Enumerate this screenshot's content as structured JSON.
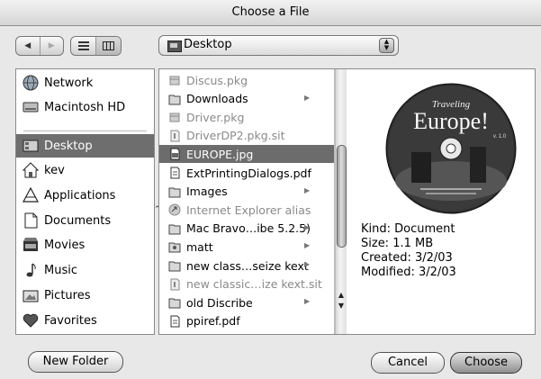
{
  "window": {
    "title": "Choose a File"
  },
  "toolbar": {
    "back_icon": "back-arrow-icon",
    "forward_icon": "forward-arrow-icon",
    "list_view_icon": "list-view-icon",
    "column_view_icon": "column-view-icon",
    "location": {
      "label": "Desktop",
      "icon": "desktop-icon"
    }
  },
  "sidebar": {
    "items": [
      {
        "label": "Network",
        "icon": "network-icon",
        "selected": false
      },
      {
        "label": "Macintosh HD",
        "icon": "hard-drive-icon",
        "selected": false
      },
      {
        "label": "Desktop",
        "icon": "desktop-icon",
        "selected": true
      },
      {
        "label": "kev",
        "icon": "home-icon",
        "selected": false
      },
      {
        "label": "Applications",
        "icon": "applications-icon",
        "selected": false
      },
      {
        "label": "Documents",
        "icon": "documents-icon",
        "selected": false
      },
      {
        "label": "Movies",
        "icon": "movies-icon",
        "selected": false
      },
      {
        "label": "Music",
        "icon": "music-icon",
        "selected": false
      },
      {
        "label": "Pictures",
        "icon": "pictures-icon",
        "selected": false
      },
      {
        "label": "Favorites",
        "icon": "favorites-icon",
        "selected": false
      }
    ]
  },
  "files": [
    {
      "name": "Discus.pkg",
      "icon": "package-icon",
      "dimmed": true,
      "folder": false,
      "selected": false
    },
    {
      "name": "Downloads",
      "icon": "folder-icon",
      "dimmed": false,
      "folder": true,
      "selected": false
    },
    {
      "name": "Driver.pkg",
      "icon": "package-icon",
      "dimmed": true,
      "folder": false,
      "selected": false
    },
    {
      "name": "DriverDP2.pkg.sit",
      "icon": "archive-icon",
      "dimmed": true,
      "folder": false,
      "selected": false
    },
    {
      "name": "EUROPE.jpg",
      "icon": "image-file-icon",
      "dimmed": false,
      "folder": false,
      "selected": true
    },
    {
      "name": "ExtPrintingDialogs.pdf",
      "icon": "pdf-icon",
      "dimmed": false,
      "folder": false,
      "selected": false
    },
    {
      "name": "Images",
      "icon": "folder-icon",
      "dimmed": false,
      "folder": true,
      "selected": false
    },
    {
      "name": "Internet Explorer alias",
      "icon": "alias-icon",
      "dimmed": true,
      "folder": false,
      "selected": false
    },
    {
      "name": "Mac Bravo…ibe 5.2.5)",
      "icon": "folder-icon",
      "dimmed": false,
      "folder": true,
      "selected": false
    },
    {
      "name": "matt",
      "icon": "user-folder-icon",
      "dimmed": false,
      "folder": true,
      "selected": false
    },
    {
      "name": "new class…seize kext",
      "icon": "folder-icon",
      "dimmed": false,
      "folder": true,
      "selected": false
    },
    {
      "name": "new classic…ize kext.sit",
      "icon": "archive-icon",
      "dimmed": true,
      "folder": false,
      "selected": false
    },
    {
      "name": "old Discribe",
      "icon": "folder-icon",
      "dimmed": false,
      "folder": true,
      "selected": false
    },
    {
      "name": "ppiref.pdf",
      "icon": "pdf-icon",
      "dimmed": false,
      "folder": false,
      "selected": false
    }
  ],
  "preview": {
    "image_icon": "cd-artwork-preview",
    "cd_title_line1": "Traveling",
    "cd_title_line2": "Europe!",
    "cd_version": "v. 1.0",
    "kind": "Kind: Document",
    "size": "Size: 1.1 MB",
    "created": "Created: 3/2/03",
    "modified": "Modified: 3/2/03"
  },
  "buttons": {
    "new_folder": "New Folder",
    "cancel": "Cancel",
    "choose": "Choose"
  }
}
